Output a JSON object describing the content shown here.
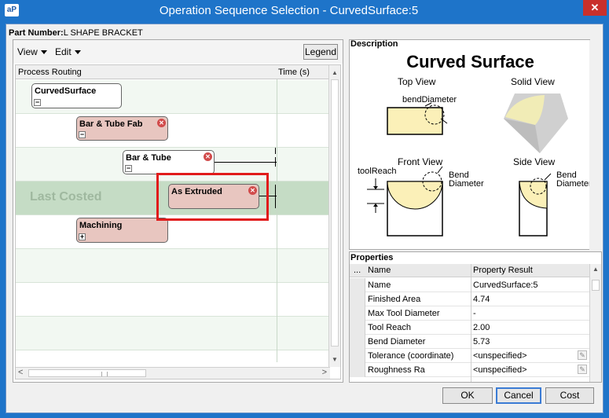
{
  "window": {
    "app_icon": "aP",
    "title": "Operation Sequence Selection - CurvedSurface:5",
    "close_glyph": "✕"
  },
  "part": {
    "label": "Part Number:",
    "value": "L SHAPE BRACKET"
  },
  "toolbar": {
    "view": "View",
    "edit": "Edit",
    "legend": "Legend"
  },
  "routing": {
    "col_routing": "Process Routing",
    "col_time": "Time (s)",
    "last_costed": "Last Costed",
    "nodes": [
      {
        "label": "CurvedSurface",
        "color": "white",
        "expander": "−"
      },
      {
        "label": "Bar & Tube Fab",
        "color": "pink",
        "expander": "−"
      },
      {
        "label": "Bar & Tube",
        "color": "white",
        "expander": "−"
      },
      {
        "label": "As Extruded",
        "color": "pink",
        "expander": "",
        "highlighted": true
      },
      {
        "label": "Machining",
        "color": "pink",
        "expander": "+"
      }
    ],
    "remove_glyph": "✕"
  },
  "description": {
    "title": "Description",
    "heading": "Curved Surface",
    "top_view": "Top View",
    "solid_view": "Solid View",
    "front_view": "Front View",
    "side_view": "Side View",
    "bend_diameter_label": "bendDiameter",
    "tool_reach_label": "toolReach",
    "bend_label_1": "Bend",
    "bend_label_2": "Diameter"
  },
  "properties": {
    "title": "Properties",
    "col_expand": "...",
    "col_name": "Name",
    "col_result": "Property Result",
    "rows": [
      {
        "name": "Name",
        "value": "CurvedSurface:5",
        "editable": false
      },
      {
        "name": "Finished Area",
        "value": "4.74",
        "editable": false
      },
      {
        "name": "Max Tool Diameter",
        "value": "-",
        "editable": false
      },
      {
        "name": "Tool Reach",
        "value": "2.00",
        "editable": false
      },
      {
        "name": "Bend Diameter",
        "value": "5.73",
        "editable": false
      },
      {
        "name": "Tolerance (coordinate)",
        "value": "<unspecified>",
        "editable": true
      },
      {
        "name": "Roughness Ra",
        "value": "<unspecified>",
        "editable": true
      }
    ]
  },
  "buttons": {
    "ok": "OK",
    "cancel": "Cancel",
    "cost": "Cost"
  },
  "colors": {
    "titlebar": "#1e74c9",
    "costed_row": "#c5dcc5",
    "highlight": "#e11b1b",
    "node_pink": "#e8c6c0"
  }
}
